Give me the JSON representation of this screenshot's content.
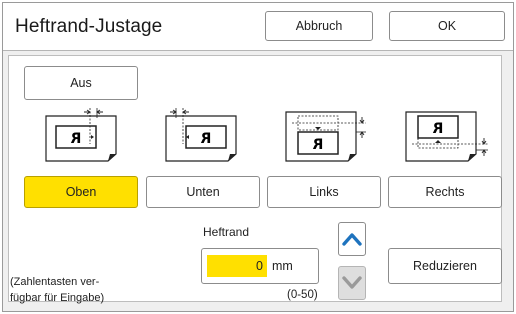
{
  "dialog": {
    "title": "Heftrand-Justage",
    "cancel_label": "Abbruch",
    "ok_label": "OK"
  },
  "off_button": {
    "label": "Aus"
  },
  "position_options": [
    {
      "label": "Oben",
      "selected": true
    },
    {
      "label": "Unten",
      "selected": false
    },
    {
      "label": "Links",
      "selected": false
    },
    {
      "label": "Rechts",
      "selected": false
    }
  ],
  "binding_margin": {
    "label": "Heftrand",
    "value": "0",
    "unit": "mm",
    "range": "(0-50)"
  },
  "reduce_button": {
    "label": "Reduzieren"
  },
  "hint": {
    "line1": "(Zahlentasten ver-",
    "line2": "fügbar für Eingabe)"
  },
  "colors": {
    "selected": "#ffe000",
    "arrow_active": "#1e73be",
    "arrow_disabled": "#9a9a9a"
  }
}
